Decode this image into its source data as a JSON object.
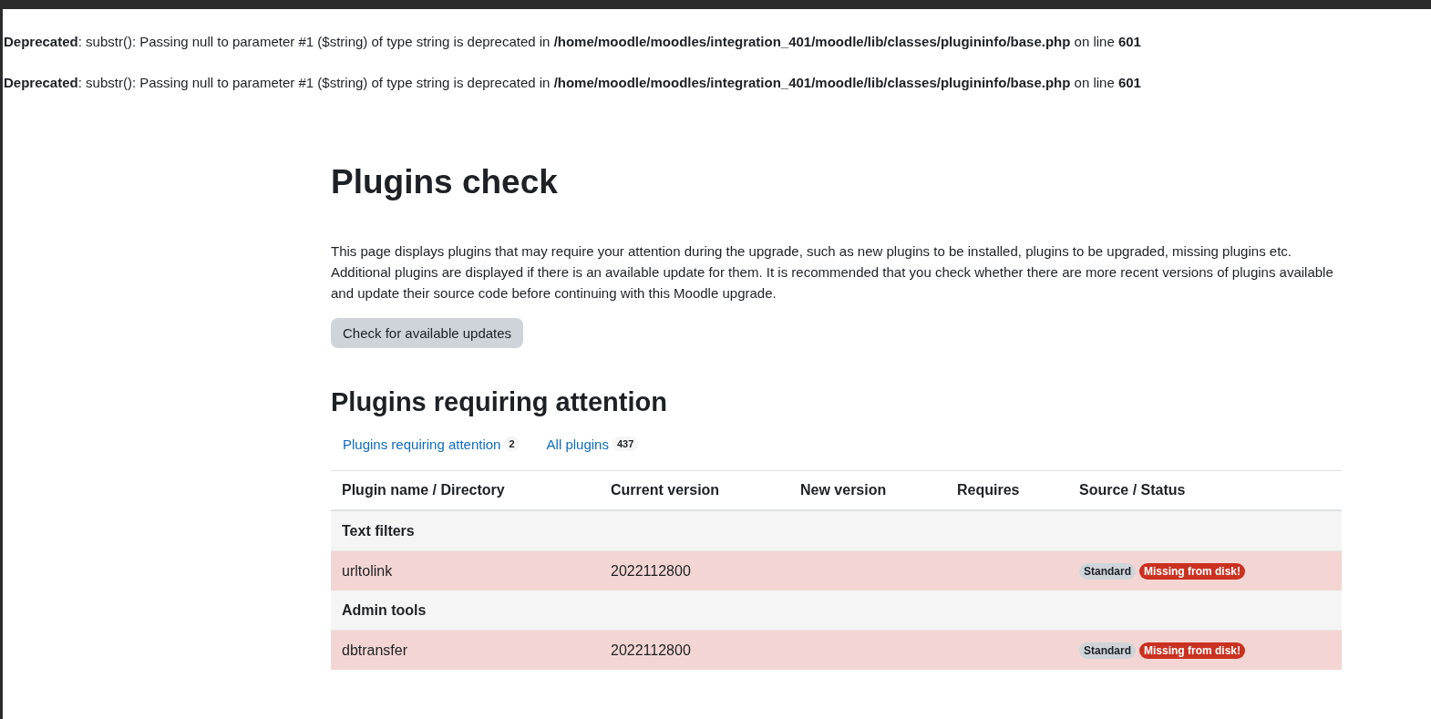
{
  "notices": [
    "**Deprecated**: substr(): Passing null to parameter #1 ($string) of type string is deprecated in **/home/moodle/moodles/integration_401/moodle/lib/classes/plugininfo/base.php** on line **601**",
    "**Deprecated**: substr(): Passing null to parameter #1 ($string) of type string is deprecated in **/home/moodle/moodles/integration_401/moodle/lib/classes/plugininfo/base.php** on line **601**"
  ],
  "title": "Plugins check",
  "intro": "This page displays plugins that may require your attention during the upgrade, such as new plugins to be installed, plugins to be upgraded, missing plugins etc. Additional plugins are displayed if there is an available update for them. It is recommended that you check whether there are more recent versions of plugins available and update their source code before continuing with this Moodle upgrade.",
  "check_button": "Check for available updates",
  "section_title": "Plugins requiring attention",
  "tabs": [
    {
      "label": "Plugins requiring attention",
      "count": "2"
    },
    {
      "label": "All plugins",
      "count": "437"
    }
  ],
  "table": {
    "columns": [
      "Plugin name / Directory",
      "Current version",
      "New version",
      "Requires",
      "Source / Status"
    ],
    "rows": [
      {
        "kind": "group",
        "name": "Text filters"
      },
      {
        "kind": "plugin",
        "name": "urltolink",
        "current_version": "2022112800",
        "badges": [
          {
            "kind": "source",
            "label": "Standard"
          },
          {
            "kind": "missing",
            "label": "Missing from disk!"
          }
        ]
      },
      {
        "kind": "group",
        "name": "Admin tools"
      },
      {
        "kind": "plugin",
        "name": "dbtransfer",
        "current_version": "2022112800",
        "badges": [
          {
            "kind": "source",
            "label": "Standard"
          },
          {
            "kind": "missing",
            "label": "Missing from disk!"
          }
        ]
      }
    ]
  }
}
